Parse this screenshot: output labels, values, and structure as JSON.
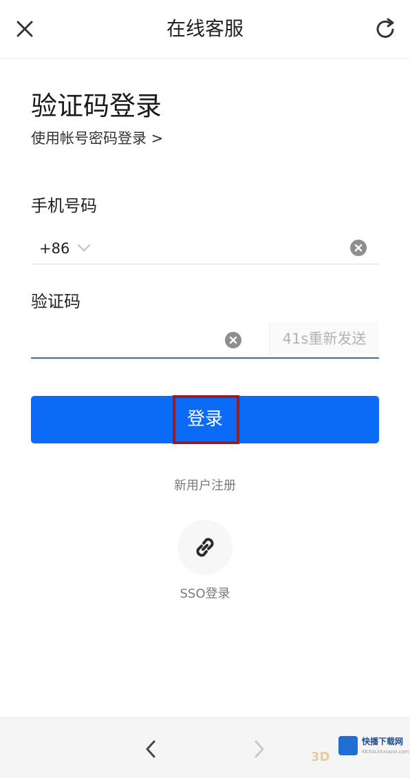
{
  "header": {
    "title": "在线客服",
    "close_icon": "close-icon",
    "refresh_icon": "refresh-icon"
  },
  "login": {
    "title": "验证码登录",
    "switch_link": "使用帐号密码登录 >",
    "phone_label": "手机号码",
    "country_code": "+86",
    "phone_value": "",
    "code_label": "验证码",
    "code_value": "",
    "resend_label": "41s重新发送",
    "submit_label": "登录",
    "register_link": "新用户注册",
    "sso_label": "SSO登录",
    "sso_icon": "link-icon"
  },
  "watermark": {
    "brand": "快播下载网",
    "sub": "KKXIA.kkxiazai.com",
    "tag": "3D"
  },
  "colors": {
    "primary": "#0b6bf7",
    "highlight": "#9b1b22",
    "muted": "#7a7a7a",
    "resend_disabled": "#b3b3b3"
  }
}
